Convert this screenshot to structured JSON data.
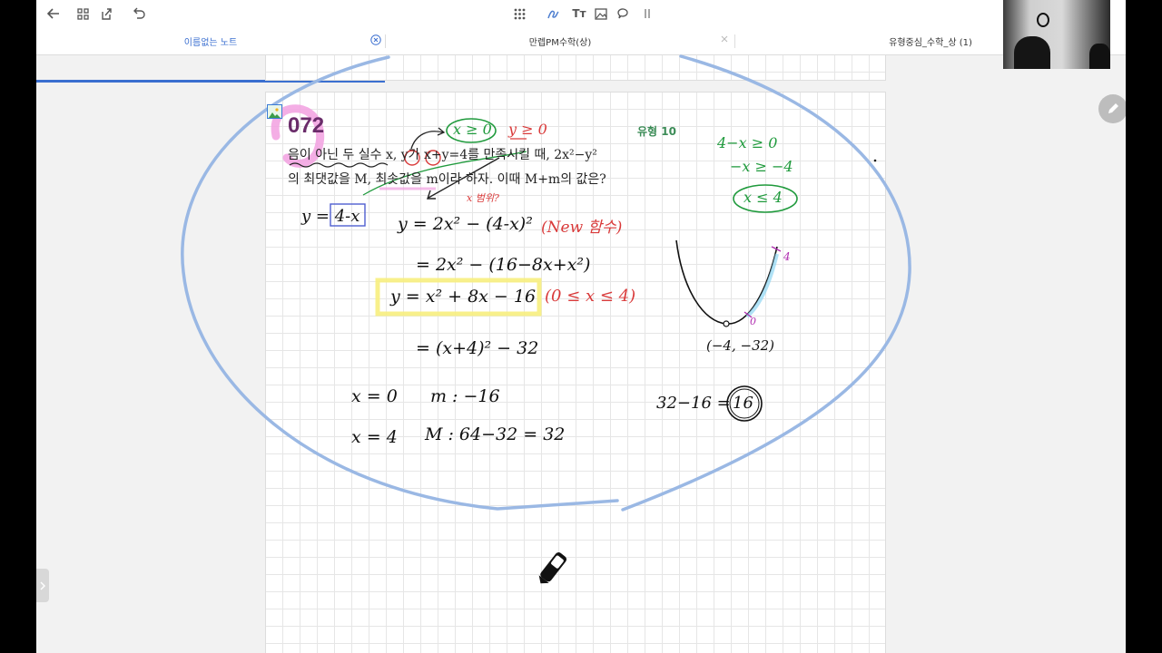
{
  "toolbar": {
    "left_icons": [
      "back-arrow-icon",
      "grid-icon",
      "export-icon",
      "undo-icon"
    ],
    "center_icons": [
      "apps-grid-icon",
      "pen-icon",
      "text-tool-icon",
      "image-tool-icon",
      "comment-icon",
      "more-icon"
    ],
    "text_tool_label": "Tт"
  },
  "tabs": [
    {
      "label": "이름없는 노트",
      "active": true
    },
    {
      "label": "만렙PM수학(상)",
      "active": false
    },
    {
      "label": "유형중심_수학_상 (1)",
      "active": false
    }
  ],
  "problem": {
    "number": "072",
    "type_label": "유형 10",
    "line1": "음이 아닌 두 실수 x, y가 x+y=4를 만족시킬 때, 2x²−y²",
    "line2": "의 최댓값을 M, 최솟값을 m이라 하자. 이때 M+m의 값은?"
  },
  "handwriting": {
    "cond_x": "x ≥ 0",
    "cond_y": "y ≥ 0",
    "range_note": "x 범위?",
    "y_sub": "y = 4-x",
    "eq1": "y = 2x² − (4-x)²",
    "new_func": "(New 함수)",
    "eq2": "= 2x² − (16−8x+x²)",
    "eq3": "y = x² + 8x − 16",
    "domain": "(0 ≤ x ≤ 4)",
    "eq4": "= (x+4)² − 32",
    "min_x": "x = 0",
    "min_label": "m : −16",
    "max_x": "x = 4",
    "max_label": "M : 64−32 = 32",
    "ineq1": "4−x ≥ 0",
    "ineq2": "−x ≥ −4",
    "ineq3": "x ≤ 4",
    "vertex": "(−4, −32)",
    "graph_end": "4",
    "graph_start": "0",
    "answer_calc": "32−16 =",
    "answer": "16"
  },
  "colors": {
    "accent": "#3b6fd0",
    "pen_black": "#111111",
    "pen_red": "#d93a3a",
    "pen_green": "#1f9a3c",
    "pen_blue": "#4f5fd0",
    "highlight_yellow": "#f7ee7e",
    "highlight_pink": "#f2a0e0",
    "lasso_blue": "#9ab8e4"
  }
}
